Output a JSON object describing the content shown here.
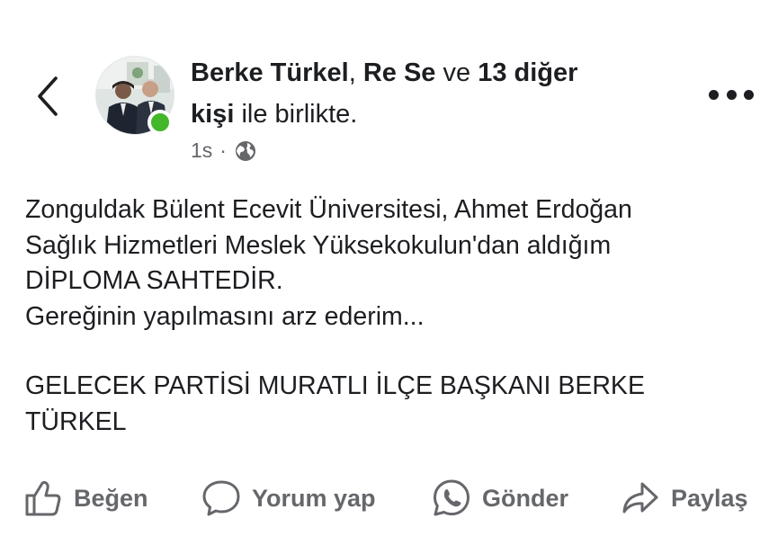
{
  "post": {
    "author_primary": "Berke Türkel",
    "sep_comma": ",",
    "author_secondary": "Re Se",
    "connector": "ve",
    "others": "13 diğer",
    "others_tail": "kişi",
    "with_text": "ile birlikte.",
    "time": "1s",
    "dot": "·",
    "audience_icon": "globe-icon",
    "online": true,
    "online_color": "#42b72a",
    "body_lines": [
      "Zonguldak Bülent Ecevit Üniversitesi, Ahmet Erdoğan",
      "Sağlık Hizmetleri Meslek Yüksekokulun'dan aldığım",
      "DİPLOMA SAHTEDİR.",
      "Gereğinin yapılmasını arz ederim...",
      "GELECEK PARTİSİ MURATLI İLÇE BAŞKANI  BERKE",
      "TÜRKEL"
    ]
  },
  "actions": {
    "like": "Beğen",
    "comment": "Yorum yap",
    "send": "Gönder",
    "share": "Paylaş"
  },
  "icons": {
    "back": "chevron-left-icon",
    "more": "more-dots-icon",
    "like": "thumbs-up-icon",
    "comment": "comment-bubble-icon",
    "send": "whatsapp-icon",
    "share": "share-arrow-icon"
  },
  "colors": {
    "text": "#1c1e21",
    "secondary": "#65676b",
    "online": "#42b72a"
  }
}
